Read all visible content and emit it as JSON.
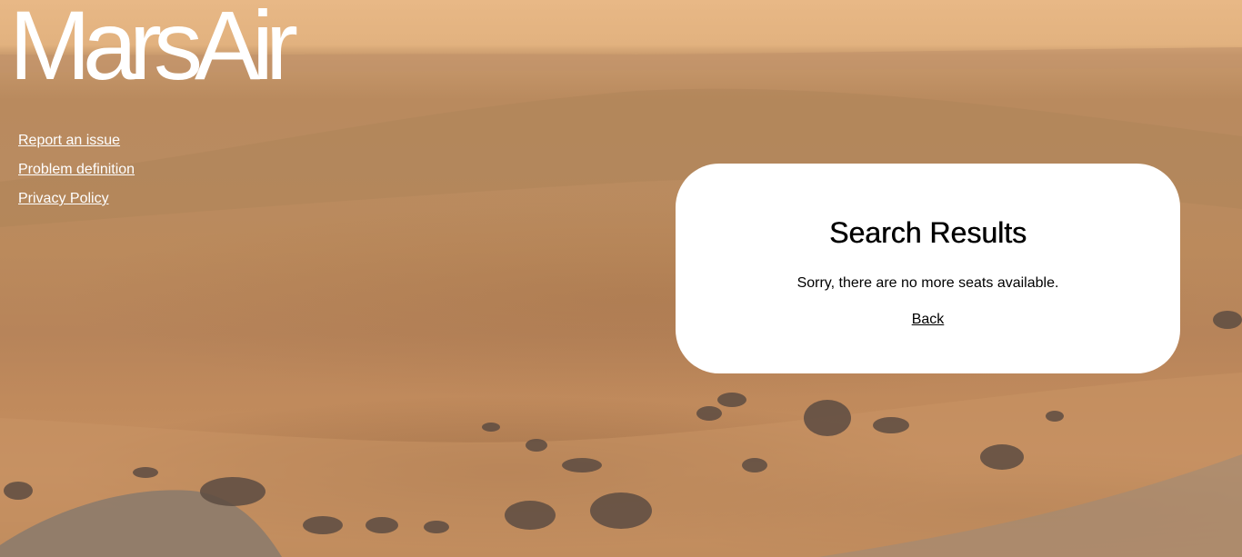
{
  "app": {
    "logo_text": "MarsAir"
  },
  "nav": {
    "links": [
      {
        "label": "Report an issue"
      },
      {
        "label": "Problem definition"
      },
      {
        "label": "Privacy Policy"
      }
    ]
  },
  "results": {
    "heading": "Search Results",
    "message": "Sorry, there are no more seats available.",
    "back_label": "Back"
  },
  "theme": {
    "sky": "#e8b886",
    "terrain": "#b98a5e",
    "card_background": "#ffffff",
    "text": "#000000"
  }
}
